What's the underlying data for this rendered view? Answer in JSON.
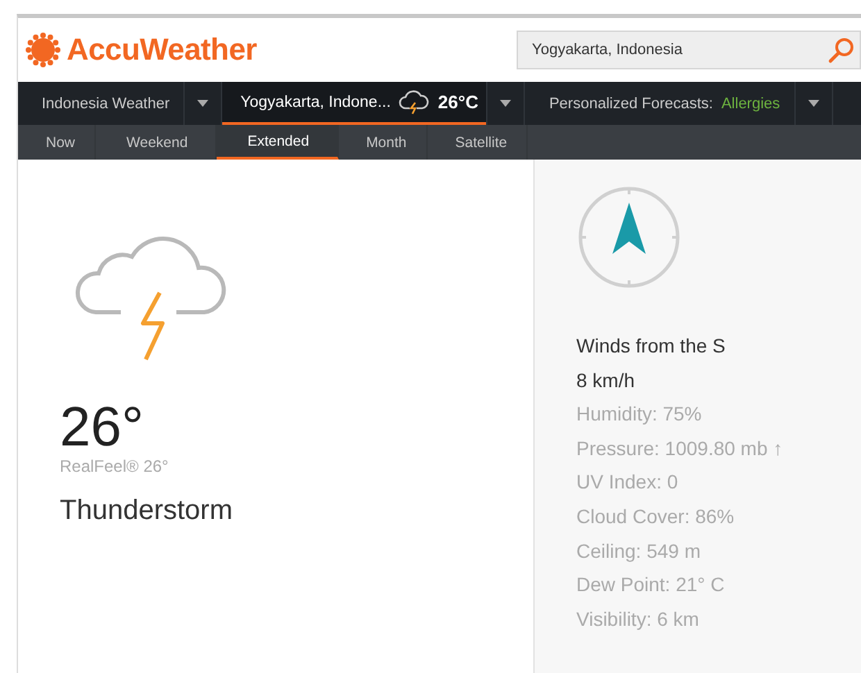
{
  "header": {
    "logo": "AccuWeather",
    "search": {
      "value": "Yogyakarta, Indonesia"
    }
  },
  "nav": [
    {
      "label": "Indonesia Weather",
      "selected": false
    },
    {
      "label": "Yogyakarta, Indone...",
      "temp": "26°C",
      "selected": true
    },
    {
      "label": "Personalized Forecasts:",
      "highlight": "Allergies",
      "selected": false
    }
  ],
  "tabs": [
    {
      "label": "Now",
      "selected": false
    },
    {
      "label": "Weekend",
      "selected": false
    },
    {
      "label": "Extended",
      "selected": true
    },
    {
      "label": "Month",
      "selected": false
    },
    {
      "label": "Satellite",
      "selected": false
    }
  ],
  "current": {
    "temperature": "26°",
    "realfeel": "RealFeel® 26°",
    "phrase": "Thunderstorm"
  },
  "details": [
    {
      "kind": "primary",
      "text": "Winds from the S"
    },
    {
      "kind": "primary",
      "text": "8 km/h"
    },
    {
      "kind": "secondary",
      "text": "Humidity: 75%"
    },
    {
      "kind": "secondary",
      "text": "Pressure: 1009.80 mb ↑"
    },
    {
      "kind": "secondary",
      "text": "UV Index: 0"
    },
    {
      "kind": "secondary",
      "text": "Cloud Cover: 86%"
    },
    {
      "kind": "secondary",
      "text": "Ceiling: 549 m"
    },
    {
      "kind": "secondary",
      "text": "Dew Point: 21° C"
    },
    {
      "kind": "secondary",
      "text": "Visibility: 6 km"
    }
  ]
}
